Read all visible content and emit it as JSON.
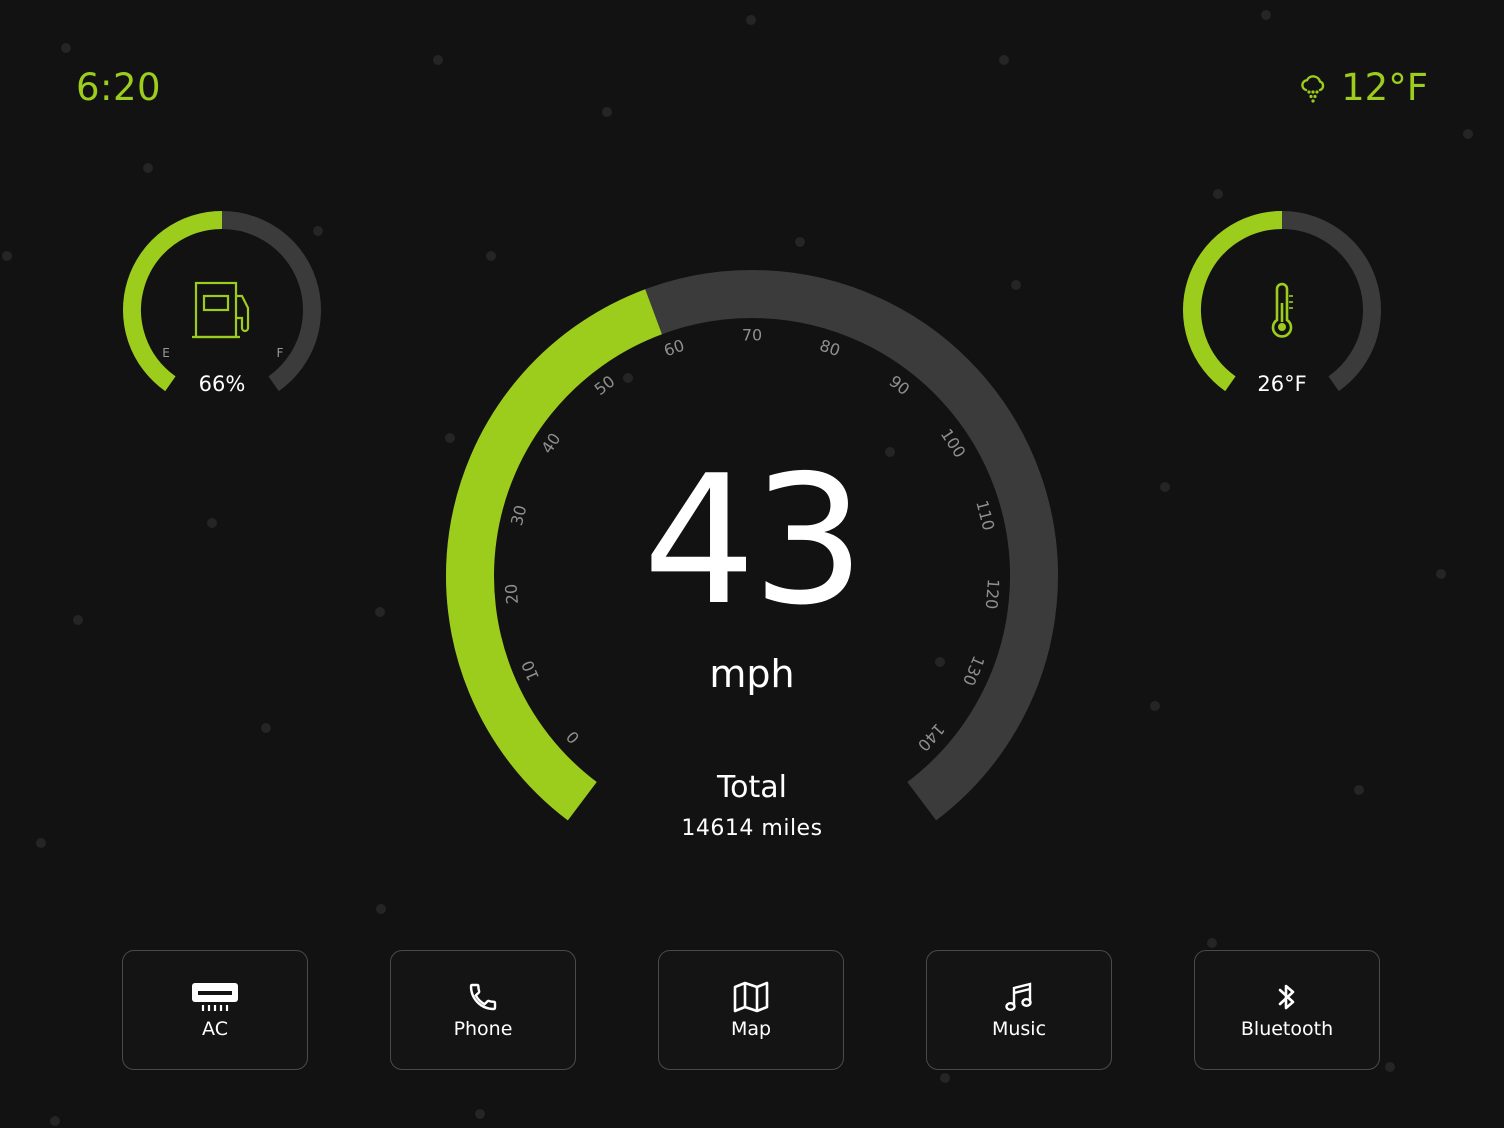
{
  "status_bar": {
    "time": "6:20",
    "weather_icon": "cloud-snow-icon",
    "temperature": "12°F"
  },
  "colors": {
    "accent": "#9ccc1c",
    "track": "#3b3b3b",
    "background": "#121212",
    "text": "#ffffff"
  },
  "fuel_gauge": {
    "icon": "fuel-pump-icon",
    "value_percent": 66,
    "label": "66%",
    "empty_label": "E",
    "full_label": "F"
  },
  "temperature_gauge": {
    "icon": "thermometer-icon",
    "label": "26°F"
  },
  "speedometer": {
    "speed": "43",
    "unit": "mph",
    "max": 140,
    "ticks": [
      "0",
      "10",
      "20",
      "30",
      "40",
      "50",
      "60",
      "70",
      "80",
      "90",
      "100",
      "110",
      "120",
      "130",
      "140"
    ],
    "fill_value": 60
  },
  "odometer": {
    "label": "Total",
    "value": "14614 miles"
  },
  "dock": [
    {
      "label": "AC",
      "icon": "ac-unit-icon"
    },
    {
      "label": "Phone",
      "icon": "phone-icon"
    },
    {
      "label": "Map",
      "icon": "map-icon"
    },
    {
      "label": "Music",
      "icon": "music-note-icon"
    },
    {
      "label": "Bluetooth",
      "icon": "bluetooth-icon"
    }
  ]
}
